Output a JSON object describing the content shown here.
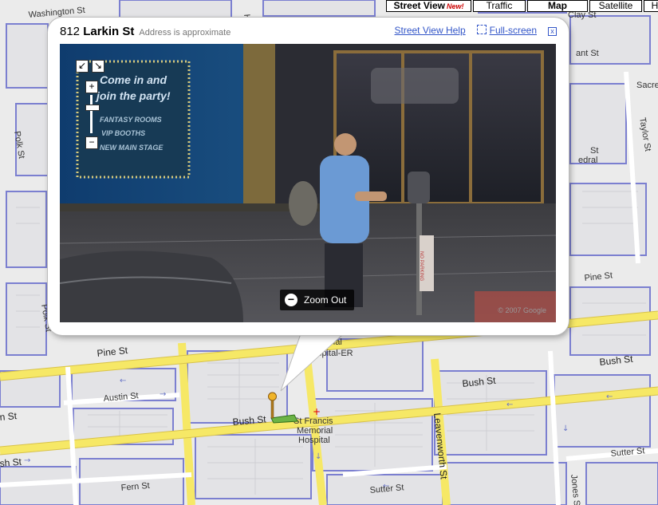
{
  "map_types": [
    {
      "label": "Street View",
      "badge": "New!"
    },
    {
      "label": "Traffic"
    },
    {
      "label": "Map"
    },
    {
      "label": "Satellite"
    },
    {
      "label": "Hy"
    }
  ],
  "street_labels": {
    "washington": "Washington St",
    "clay": "Clay St",
    "polk": "Polk St",
    "polk2": "Polk St",
    "taylor": "Taylor St",
    "pine_left": "Pine St",
    "pine_right": "Pine St",
    "austin": "Austin St",
    "bush_mid": "Bush St",
    "bush_left": "sh St",
    "bush_right": "Bush St",
    "bush_far": "Bush St",
    "sutter_left": "sh St",
    "sutter_mid": "Sutter St",
    "sutter_right": "Sutter St",
    "fern": "Fern St",
    "leavenworth": "Leavenworth St",
    "jones": "Jones St",
    "hyde": "Hy",
    "left_cut": "n St",
    "ant": "ant St",
    "sacr": "Sacre",
    "st": "St",
    "edral": "edral",
    "hospital1": "orial",
    "hospital2": "spital-ER",
    "stfrancis1": "St Francis",
    "stfrancis2": "Memorial",
    "stfrancis3": "Hospital"
  },
  "infowindow": {
    "number": "812",
    "street": "Larkin St",
    "approx": "Address is approximate",
    "help_link": "Street View Help",
    "fullscreen_link": "Full-screen",
    "close_glyph": "x",
    "zoom_out": "Zoom Out",
    "copyright": "© 2007 Google",
    "sign": [
      "Come in and",
      "join the party!",
      "FANTASY ROOMS",
      "VIP BOOTHS",
      "NEW MAIN STAGE"
    ],
    "parking_sign": "NO PARKING"
  },
  "street_view_controls": {
    "plus": "+",
    "minus": "−",
    "pan_left": "↙",
    "pan_right": "↘"
  }
}
